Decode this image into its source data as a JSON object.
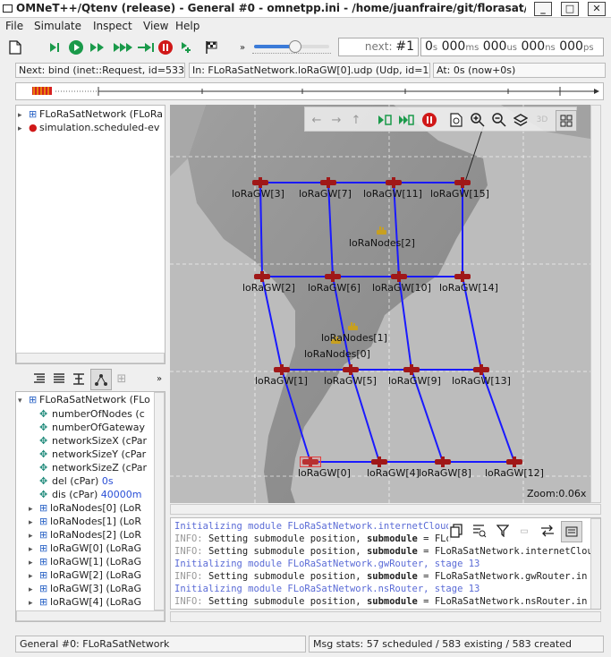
{
  "window": {
    "title": "OMNeT++/Qtenv (release) - General #0 - omnetpp.ini - /home/juanfraire/git/florasat/s..."
  },
  "menu": [
    "File",
    "Simulate",
    "Inspect",
    "View",
    "Help"
  ],
  "toolbar": {
    "next_label": "next:",
    "next_value": "#1",
    "simtime": [
      {
        "num": "0",
        "unit": "s"
      },
      {
        "num": "000",
        "unit": "ms"
      },
      {
        "num": "000",
        "unit": "us"
      },
      {
        "num": "000",
        "unit": "ns"
      },
      {
        "num": "000",
        "unit": "ps"
      }
    ],
    "speed_level": 0.55
  },
  "info": {
    "next_event": "Next: bind (inet::Request, id=533)",
    "in_module": "In: FLoRaSatNetwork.loRaGW[0].udp (Udp, id=136)",
    "at_time": "At: 0s (now+0s)"
  },
  "object_tree": {
    "items": [
      "FLoRaSatNetwork (FLoRa",
      "simulation.scheduled-ev"
    ]
  },
  "inspector": {
    "root": "FLoRaSatNetwork (FLo",
    "params": [
      {
        "label": "numberOfNodes (c",
        "value": ""
      },
      {
        "label": "numberOfGateway",
        "value": ""
      },
      {
        "label": "networkSizeX (cPar",
        "value": ""
      },
      {
        "label": "networkSizeY (cPar",
        "value": ""
      },
      {
        "label": "networkSizeZ (cPar",
        "value": ""
      },
      {
        "label": "del (cPar) ",
        "value": "0s"
      },
      {
        "label": "dis (cPar) ",
        "value": "40000m"
      }
    ],
    "submodules": [
      "loRaNodes[0] (LoR",
      "loRaNodes[1] (LoR",
      "loRaNodes[2] (LoR",
      "loRaGW[0] (LoRaG",
      "loRaGW[1] (LoRaG",
      "loRaGW[2] (LoRaG",
      "loRaGW[3] (LoRaG",
      "loRaGW[4] (LoRaG",
      "loRaGW[5] (LoRaG"
    ]
  },
  "canvas": {
    "zoom": "Zoom:0.06x",
    "gateways": [
      "loRaGW[0]",
      "loRaGW[1]",
      "loRaGW[2]",
      "loRaGW[3]",
      "loRaGW[4]",
      "loRaGW[5]",
      "loRaGW[6]",
      "loRaGW[7]",
      "loRaGW[8]",
      "loRaGW[9]",
      "loRaGW[10]",
      "loRaGW[11]",
      "loRaGW[12]",
      "loRaGW[13]",
      "loRaGW[14]",
      "loRaGW[15]"
    ],
    "nodes": [
      "loRaNodes[0]",
      "loRaNodes[1]",
      "loRaNodes[2]"
    ]
  },
  "log": [
    {
      "type": "init",
      "text": "Initializing module FLoRaSatNetwork.internetCloud"
    },
    {
      "type": "info",
      "text": "Setting submodule position, ",
      "bold": "submodule",
      "rest": " = FLo"
    },
    {
      "type": "info",
      "text": "Setting submodule position, ",
      "bold": "submodule",
      "rest": " = FLoRaSatNetwork.internetClou"
    },
    {
      "type": "init",
      "text": "Initializing module FLoRaSatNetwork.gwRouter, stage 13"
    },
    {
      "type": "info",
      "text": "Setting submodule position, ",
      "bold": "submodule",
      "rest": " = FLoRaSatNetwork.gwRouter.in"
    },
    {
      "type": "init",
      "text": "Initializing module FLoRaSatNetwork.nsRouter, stage 13"
    },
    {
      "type": "info",
      "text": "Setting submodule position, ",
      "bold": "submodule",
      "rest": " = FLoRaSatNetwork.nsRouter.in"
    }
  ],
  "status": {
    "left": "General #0: FLoRaSatNetwork",
    "right": "Msg stats: 57 scheduled / 583 existing / 583 created"
  },
  "colors": {
    "link": "#1a1aff",
    "gateway": "#a01818",
    "init_log": "#5a6bd6"
  }
}
